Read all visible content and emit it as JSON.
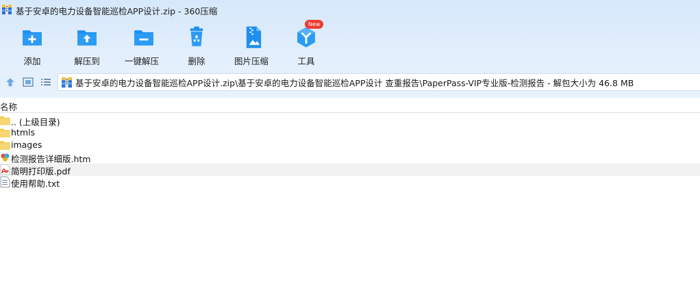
{
  "window": {
    "title": "基于安卓的电力设备智能巡检APP设计.zip - 360压缩"
  },
  "toolbar": {
    "items": [
      {
        "label": "添加",
        "icon": "add-icon"
      },
      {
        "label": "解压到",
        "icon": "extract-to-icon"
      },
      {
        "label": "一键解压",
        "icon": "one-click-extract-icon"
      },
      {
        "label": "删除",
        "icon": "delete-icon"
      },
      {
        "label": "图片压缩",
        "icon": "image-compress-icon"
      },
      {
        "label": "工具",
        "icon": "tools-icon",
        "badge": "New"
      }
    ],
    "accent": "#1e8ff0",
    "badge_color": "#ee3b2f"
  },
  "nav": {
    "path": "基于安卓的电力设备智能巡检APP设计.zip\\基于安卓的电力设备智能巡检APP设计 查重报告\\PaperPass-VIP专业版-检测报告 - 解包大小为 46.8 MB"
  },
  "list": {
    "column_name": "名称",
    "files": [
      {
        "name": ".. (上级目录)",
        "type": "parent-folder"
      },
      {
        "name": "htmls",
        "type": "folder"
      },
      {
        "name": "images",
        "type": "folder"
      },
      {
        "name": "检测报告详细版.htm",
        "type": "html"
      },
      {
        "name": "简明打印版.pdf",
        "type": "pdf"
      },
      {
        "name": "使用帮助.txt",
        "type": "txt"
      }
    ]
  }
}
